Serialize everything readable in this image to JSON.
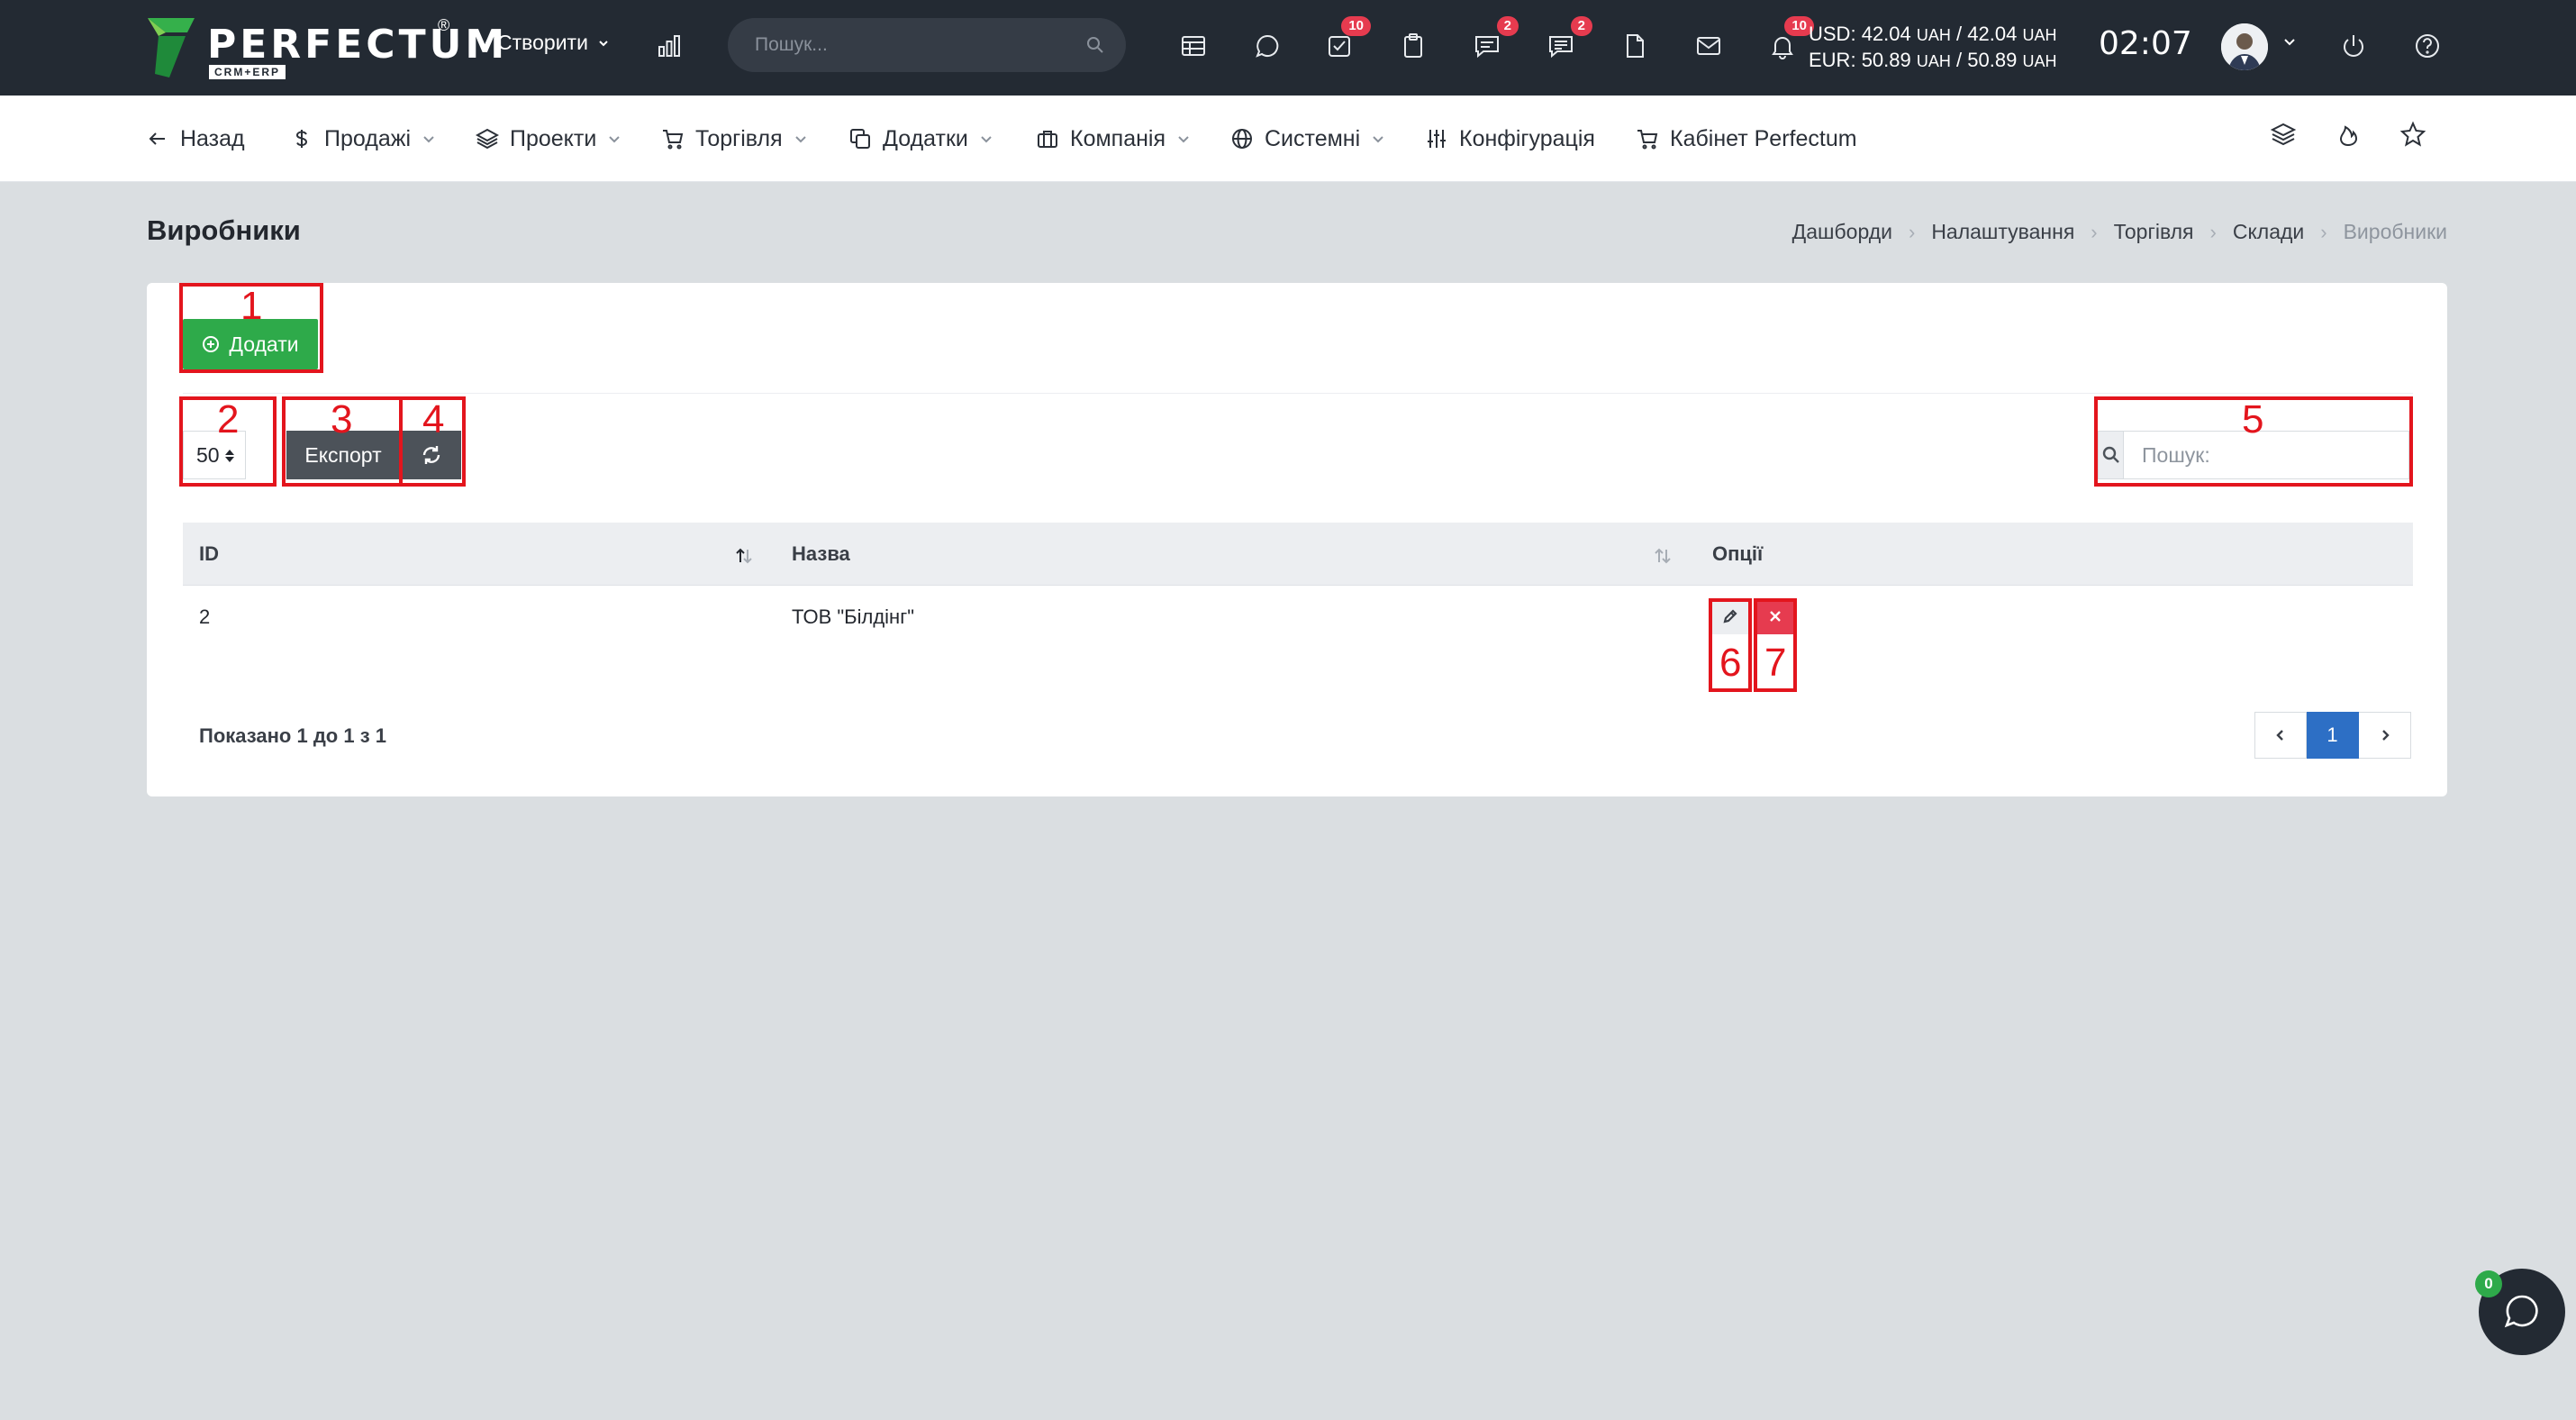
{
  "brand": {
    "name": "PERFECTUM",
    "registered": "®",
    "sub": "CRM+ERP",
    "accent_green": "#2eaa4a"
  },
  "topbar": {
    "create_label": "Створити",
    "search_placeholder": "Пошук...",
    "icons": [
      "bar-chart-icon",
      "calendar-table-icon",
      "chat-bubble-icon",
      "task-check-icon",
      "clipboard-icon",
      "messages-icon",
      "comments-icon",
      "document-icon",
      "mail-icon",
      "bell-icon"
    ],
    "badges": {
      "tasks": "10",
      "messages": "2",
      "comments": "2",
      "notifications": "10"
    },
    "rates": {
      "usd_label": "USD:",
      "usd_buy": "42.04",
      "usd_sell": "42.04",
      "eur_label": "EUR:",
      "eur_buy": "50.89",
      "eur_sell": "50.89",
      "currency": "UAH",
      "slash": "/"
    },
    "clock": "02:07"
  },
  "nav": {
    "items": [
      {
        "label": "Назад",
        "icon": "arrow-left-icon"
      },
      {
        "label": "Продажі",
        "icon": "dollar-icon"
      },
      {
        "label": "Проекти",
        "icon": "layers-icon"
      },
      {
        "label": "Торгівля",
        "icon": "cart-icon"
      },
      {
        "label": "Додатки",
        "icon": "copy-icon"
      },
      {
        "label": "Компанія",
        "icon": "briefcase-icon"
      },
      {
        "label": "Системні",
        "icon": "globe-icon"
      },
      {
        "label": "Конфігурація",
        "icon": "sliders-icon"
      },
      {
        "label": "Кабінет Perfectum",
        "icon": "shopping-cart-icon"
      }
    ]
  },
  "page": {
    "title": "Виробники",
    "breadcrumb": [
      "Дашборди",
      "Налаштування",
      "Торгівля",
      "Склади",
      "Виробники"
    ]
  },
  "toolbar": {
    "add_label": "Додати",
    "page_length": "50",
    "export_label": "Експорт",
    "search_placeholder": "Пошук:"
  },
  "annotations": [
    "1",
    "2",
    "3",
    "4",
    "5",
    "6",
    "7"
  ],
  "annotation_color": "#e3151d",
  "table": {
    "columns": [
      "ID",
      "Назва",
      "Опції"
    ],
    "rows": [
      {
        "id": "2",
        "name": "ТОВ \"Білдінг\""
      }
    ],
    "showing": "Показано 1 до 1 з 1",
    "current_page": "1"
  },
  "chat": {
    "unread": "0"
  }
}
